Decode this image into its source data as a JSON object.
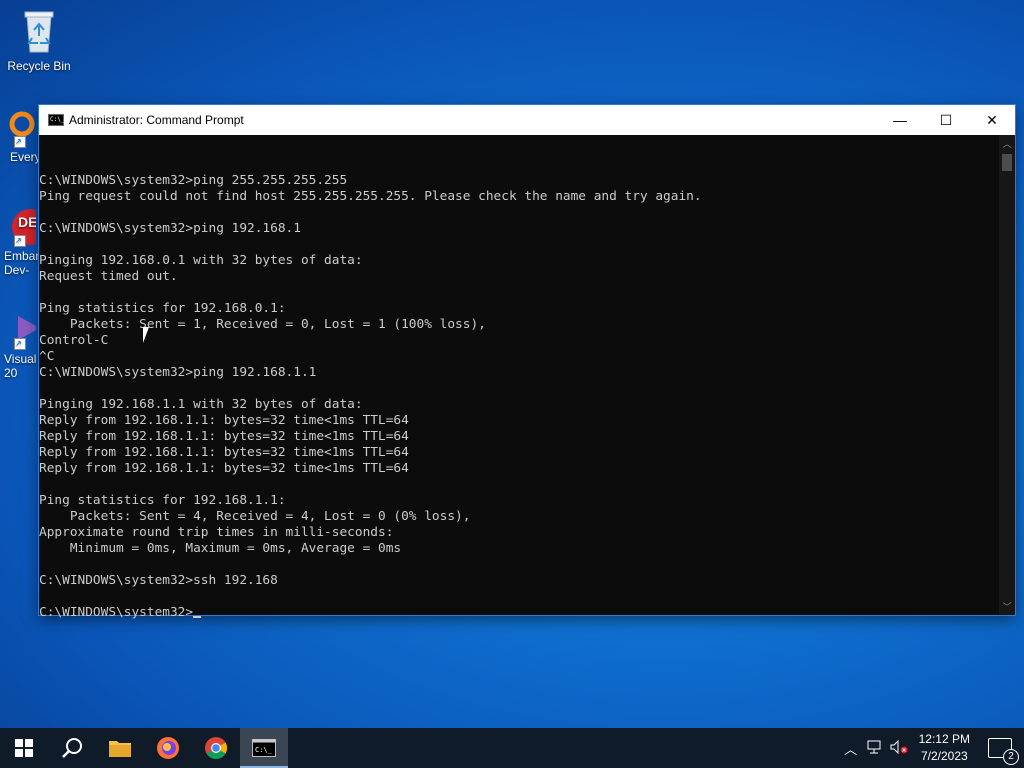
{
  "desktop": {
    "icons": [
      {
        "label": "Recycle Bin"
      },
      {
        "label": "Every"
      },
      {
        "label": "Embar Dev-"
      },
      {
        "label": "Visual 20"
      }
    ]
  },
  "window": {
    "title": "Administrator: Command Prompt",
    "minimize_glyph": "—",
    "maximize_glyph": "☐",
    "close_glyph": "✕"
  },
  "console": {
    "lines": [
      "C:\\WINDOWS\\system32>ping 255.255.255.255",
      "Ping request could not find host 255.255.255.255. Please check the name and try again.",
      "",
      "C:\\WINDOWS\\system32>ping 192.168.1",
      "",
      "Pinging 192.168.0.1 with 32 bytes of data:",
      "Request timed out.",
      "",
      "Ping statistics for 192.168.0.1:",
      "    Packets: Sent = 1, Received = 0, Lost = 1 (100% loss),",
      "Control-C",
      "^C",
      "C:\\WINDOWS\\system32>ping 192.168.1.1",
      "",
      "Pinging 192.168.1.1 with 32 bytes of data:",
      "Reply from 192.168.1.1: bytes=32 time<1ms TTL=64",
      "Reply from 192.168.1.1: bytes=32 time<1ms TTL=64",
      "Reply from 192.168.1.1: bytes=32 time<1ms TTL=64",
      "Reply from 192.168.1.1: bytes=32 time<1ms TTL=64",
      "",
      "Ping statistics for 192.168.1.1:",
      "    Packets: Sent = 4, Received = 4, Lost = 0 (0% loss),",
      "Approximate round trip times in milli-seconds:",
      "    Minimum = 0ms, Maximum = 0ms, Average = 0ms",
      "",
      "C:\\WINDOWS\\system32>ssh 192.168",
      "",
      "C:\\WINDOWS\\system32>"
    ]
  },
  "taskbar": {
    "apps": [
      "start-icon",
      "search-icon",
      "file-explorer-icon",
      "firefox-icon",
      "chrome-icon",
      "command-prompt-icon"
    ],
    "clock_time": "12:12 PM",
    "clock_date": "7/2/2023",
    "notification_count": "2"
  },
  "colors": {
    "console_bg": "#0c0c0c",
    "console_text": "#cccccc",
    "taskbar_bg": "#101b29"
  }
}
